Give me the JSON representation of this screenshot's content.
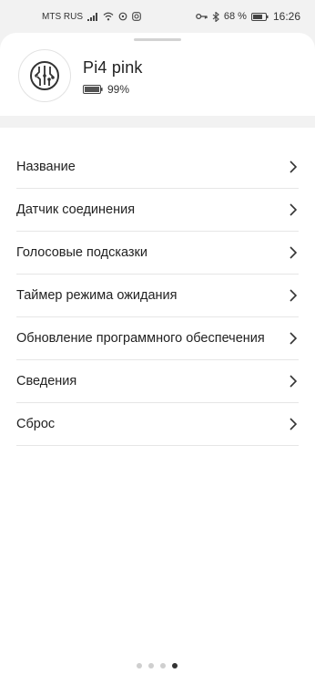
{
  "status_bar": {
    "carrier": "MTS RUS",
    "battery_percent": "68 %",
    "time": "16:26",
    "icons": [
      "signal-icon",
      "wifi-icon",
      "refresh-icon",
      "instagram-icon",
      "key-icon",
      "bluetooth-icon",
      "battery-icon"
    ]
  },
  "device": {
    "name": "Pi4 pink",
    "battery": "99%",
    "avatar_icon": "circuit-icon"
  },
  "menu": {
    "items": [
      {
        "label": "Название"
      },
      {
        "label": "Датчик соединения"
      },
      {
        "label": "Голосовые подсказки"
      },
      {
        "label": "Таймер режима ожидания"
      },
      {
        "label": "Обновление программного обеспечения"
      },
      {
        "label": "Сведения"
      },
      {
        "label": "Сброс"
      }
    ]
  },
  "pager": {
    "count": 4,
    "active_index": 3
  }
}
